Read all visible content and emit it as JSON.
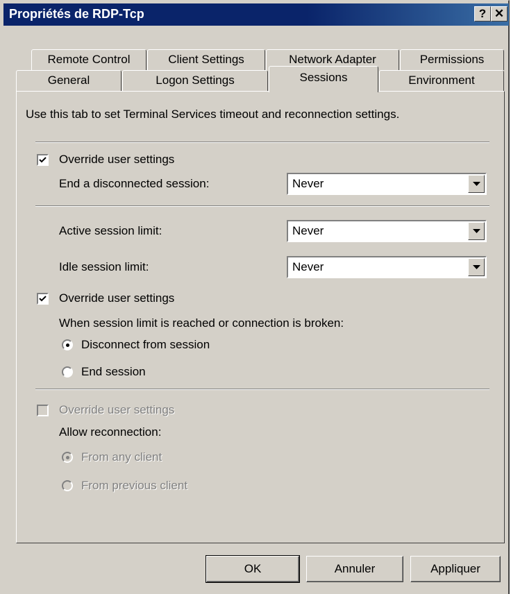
{
  "window": {
    "title": "Propriétés de RDP-Tcp",
    "help_button": "?",
    "close_button": "✕"
  },
  "tabs": {
    "row1": [
      "Remote Control",
      "Client Settings",
      "Network Adapter",
      "Permissions"
    ],
    "row2": [
      "General",
      "Logon Settings",
      "Sessions",
      "Environment"
    ],
    "active": "Sessions"
  },
  "panel": {
    "description": "Use this tab to set Terminal Services timeout and reconnection settings.",
    "group1": {
      "override_label": "Override user settings",
      "override_checked": true,
      "end_disconnected_label": "End a disconnected session:",
      "end_disconnected_value": "Never"
    },
    "group2": {
      "active_limit_label": "Active session limit:",
      "active_limit_value": "Never",
      "idle_limit_label": "Idle session limit:",
      "idle_limit_value": "Never",
      "override_label": "Override user settings",
      "override_checked": true,
      "when_label": "When session limit is reached or connection is broken:",
      "radio_disconnect": "Disconnect from session",
      "radio_end": "End session",
      "selected": "Disconnect from session"
    },
    "group3": {
      "override_label": "Override user settings",
      "override_checked": false,
      "allow_label": "Allow reconnection:",
      "radio_any": "From any client",
      "radio_previous": "From previous client",
      "selected": "From any client",
      "disabled": true
    }
  },
  "buttons": {
    "ok": "OK",
    "cancel": "Annuler",
    "apply": "Appliquer"
  }
}
